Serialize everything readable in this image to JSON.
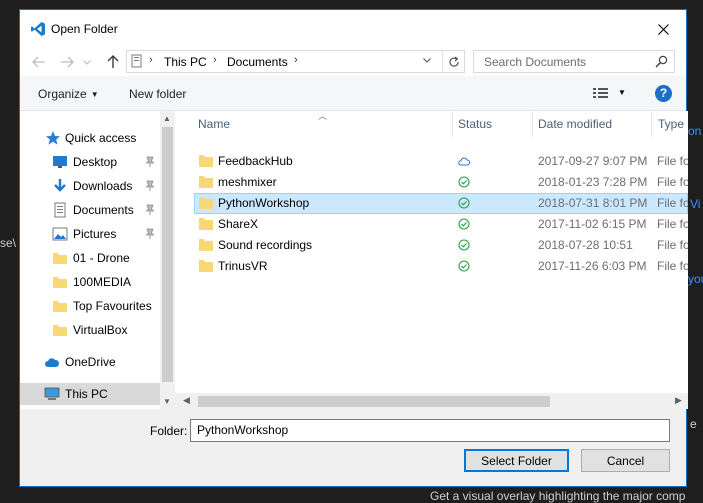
{
  "background": {
    "fragments": [
      "se\\",
      "on",
      "Vi",
      "you",
      "e",
      "Get a visual overlay highlighting the major comp"
    ]
  },
  "dialog": {
    "title": "Open Folder",
    "close_glyph": "✕"
  },
  "address": {
    "crumbs": [
      "This PC",
      "Documents"
    ],
    "search_placeholder": "Search Documents"
  },
  "commands": {
    "organize": "Organize",
    "new_folder": "New folder",
    "help": "?"
  },
  "nav": {
    "items": [
      {
        "label": "Quick access",
        "icon": "star-icon"
      },
      {
        "label": "Desktop",
        "icon": "desktop-icon",
        "pinned": true
      },
      {
        "label": "Downloads",
        "icon": "download-icon",
        "pinned": true
      },
      {
        "label": "Documents",
        "icon": "documents-icon",
        "pinned": true
      },
      {
        "label": "Pictures",
        "icon": "pictures-icon",
        "pinned": true
      },
      {
        "label": "01 - Drone",
        "icon": "folder-icon"
      },
      {
        "label": "100MEDIA",
        "icon": "folder-icon"
      },
      {
        "label": "Top Favourites",
        "icon": "folder-icon"
      },
      {
        "label": "VirtualBox",
        "icon": "folder-icon"
      },
      {
        "label": "OneDrive",
        "icon": "onedrive-icon"
      },
      {
        "label": "This PC",
        "icon": "computer-icon",
        "selected": true
      }
    ]
  },
  "files": {
    "columns": [
      "Name",
      "Status",
      "Date modified",
      "Type"
    ],
    "rows": [
      {
        "name": "FeedbackHub",
        "status": "cloud",
        "date": "2017-09-27 9:07 PM",
        "type": "File folder"
      },
      {
        "name": "meshmixer",
        "status": "synced",
        "date": "2018-01-23 7:28 PM",
        "type": "File folder"
      },
      {
        "name": "PythonWorkshop",
        "status": "synced",
        "date": "2018-07-31 8:01 PM",
        "type": "File folder",
        "selected": true
      },
      {
        "name": "ShareX",
        "status": "synced",
        "date": "2017-11-02 6:15 PM",
        "type": "File folder"
      },
      {
        "name": "Sound recordings",
        "status": "synced",
        "date": "2018-07-28 10:51",
        "type": "File folder"
      },
      {
        "name": "TrinusVR",
        "status": "synced",
        "date": "2017-11-26 6:03 PM",
        "type": "File folder"
      }
    ]
  },
  "footer": {
    "folder_label": "Folder:",
    "folder_value": "PythonWorkshop",
    "select_button": "Select Folder",
    "cancel_button": "Cancel"
  },
  "colors": {
    "accent": "#0078d7",
    "folder": "#f8d775",
    "synced": "#2e9e44",
    "cloud": "#1c7ad1",
    "selection": "#cce8ff"
  }
}
